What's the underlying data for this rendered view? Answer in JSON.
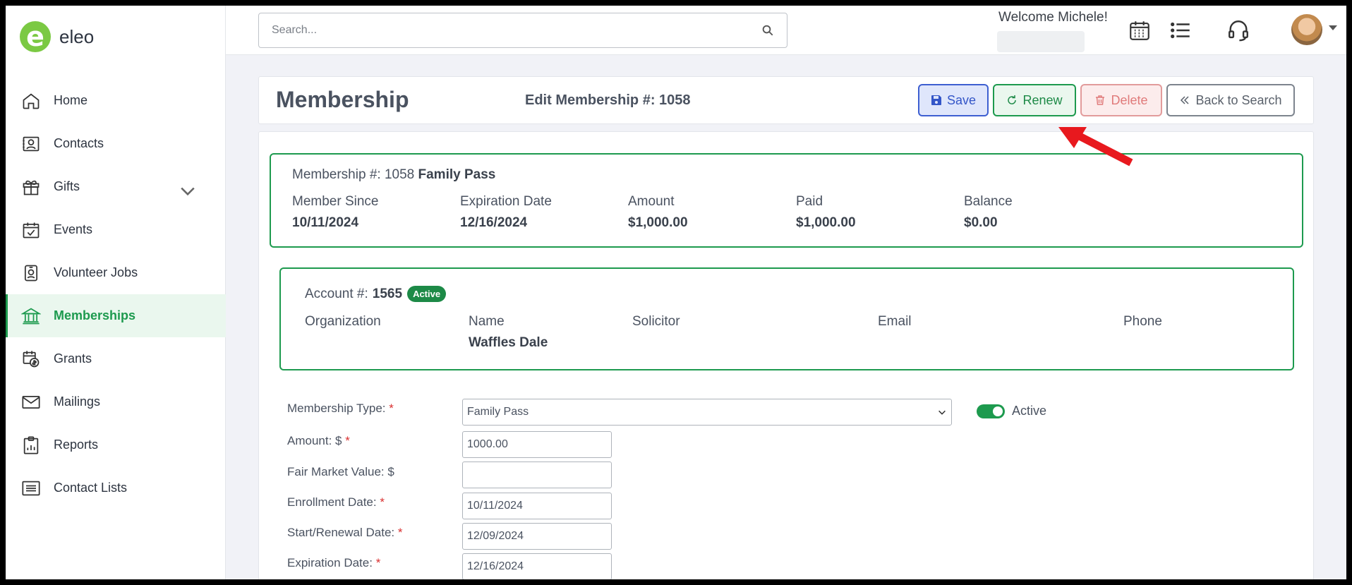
{
  "app": {
    "logo_letter": "e",
    "logo_text": "eleo"
  },
  "sidebar": {
    "items": [
      {
        "label": "Home",
        "icon": "home-icon"
      },
      {
        "label": "Contacts",
        "icon": "contact-card-icon"
      },
      {
        "label": "Gifts",
        "icon": "gift-icon"
      },
      {
        "label": "Events",
        "icon": "calendar-check-icon"
      },
      {
        "label": "Volunteer Jobs",
        "icon": "badge-icon"
      },
      {
        "label": "Memberships",
        "icon": "bank-icon",
        "active": true
      },
      {
        "label": "Grants",
        "icon": "money-calendar-icon"
      },
      {
        "label": "Mailings",
        "icon": "envelope-icon"
      },
      {
        "label": "Reports",
        "icon": "report-icon"
      },
      {
        "label": "Contact Lists",
        "icon": "list-icon"
      }
    ]
  },
  "topbar": {
    "search_placeholder": "Search...",
    "welcome": "Welcome Michele!"
  },
  "header": {
    "title": "Membership",
    "edit_title": "Edit Membership #: 1058",
    "save_label": "Save",
    "renew_label": "Renew",
    "delete_label": "Delete",
    "back_label": "Back to Search"
  },
  "summary": {
    "membership_prefix": "Membership #: 1058",
    "membership_type": "Family Pass",
    "columns": [
      {
        "label": "Member Since",
        "value": "10/11/2024"
      },
      {
        "label": "Expiration Date",
        "value": "12/16/2024"
      },
      {
        "label": "Amount",
        "value": "$1,000.00"
      },
      {
        "label": "Paid",
        "value": "$1,000.00"
      },
      {
        "label": "Balance",
        "value": "$0.00"
      }
    ]
  },
  "account": {
    "prefix": "Account #:",
    "number": "1565",
    "status": "Active",
    "columns": [
      {
        "label": "Organization",
        "value": ""
      },
      {
        "label": "Name",
        "value": "Waffles Dale"
      },
      {
        "label": "Solicitor",
        "value": ""
      },
      {
        "label": "Email",
        "value": ""
      },
      {
        "label": "Phone",
        "value": ""
      }
    ]
  },
  "form": {
    "type_label": "Membership Type:",
    "type_value": "Family Pass",
    "active_label": "Active",
    "amount_label": "Amount: $",
    "amount_value": "1000.00",
    "fmv_label": "Fair Market Value: $",
    "fmv_value": "",
    "enroll_label": "Enrollment Date:",
    "enroll_value": "10/11/2024",
    "start_label": "Start/Renewal Date:",
    "start_value": "12/09/2024",
    "exp_label": "Expiration Date:",
    "exp_value": "12/16/2024",
    "required_mark": "*"
  },
  "colors": {
    "accent": "#1d9a4e",
    "save": "#3456c8",
    "delete": "#e07a7a",
    "annotation": "#e8191e"
  }
}
